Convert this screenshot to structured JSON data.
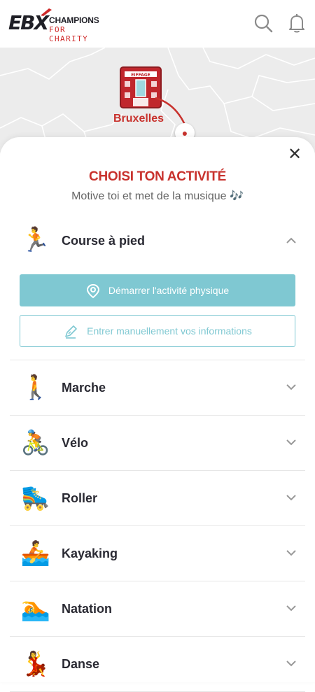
{
  "header": {
    "logo": {
      "ebx": "EBX",
      "champions": "CHAMPIONS",
      "for_charity": "FOR CHARITY"
    },
    "icons": [
      "search-icon",
      "bell-icon"
    ]
  },
  "map": {
    "city": "Bruxelles",
    "building_sign": "EIFFAGE"
  },
  "sheet": {
    "title": "CHOISI TON ACTIVITÉ",
    "subtitle": "Motive toi et met de la musique 🎶",
    "expanded": {
      "label": "Course à pied",
      "emoji": "🏃",
      "start_button": "Démarrer l'activité physique",
      "manual_button": "Entrer manuellement vos informations"
    },
    "activities": [
      {
        "label": "Marche",
        "emoji": "🚶"
      },
      {
        "label": "Vélo",
        "emoji": "🚴"
      },
      {
        "label": "Roller",
        "emoji": "🛼"
      },
      {
        "label": "Kayaking",
        "emoji": "🚣"
      },
      {
        "label": "Natation",
        "emoji": "🏊"
      },
      {
        "label": "Danse",
        "emoji": "💃"
      }
    ]
  },
  "colors": {
    "accent": "#c8322d",
    "teal": "#7fc8d2"
  }
}
